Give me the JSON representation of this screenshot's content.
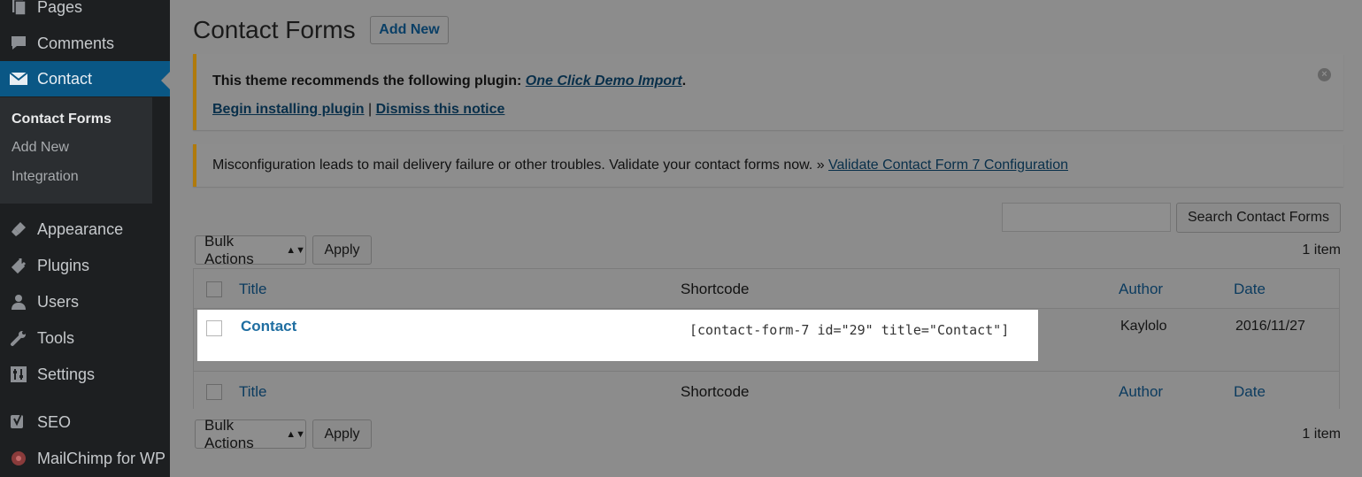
{
  "sidebar": {
    "items": [
      {
        "label": "Pages",
        "icon": "pages-icon"
      },
      {
        "label": "Comments",
        "icon": "comments-icon"
      },
      {
        "label": "Contact",
        "icon": "mail-icon",
        "active": true
      },
      {
        "label": "Appearance",
        "icon": "appearance-icon"
      },
      {
        "label": "Plugins",
        "icon": "plugins-icon"
      },
      {
        "label": "Users",
        "icon": "users-icon"
      },
      {
        "label": "Tools",
        "icon": "tools-icon"
      },
      {
        "label": "Settings",
        "icon": "settings-icon"
      },
      {
        "label": "SEO",
        "icon": "seo-icon"
      },
      {
        "label": "MailChimp for WP",
        "icon": "mailchimp-icon"
      }
    ],
    "submenu": [
      {
        "label": "Contact Forms",
        "current": true
      },
      {
        "label": "Add New"
      },
      {
        "label": "Integration"
      }
    ]
  },
  "header": {
    "title": "Contact Forms",
    "add_new_label": "Add New"
  },
  "notices": {
    "plugin_text": "This theme recommends the following plugin: ",
    "plugin_name": "One Click Demo Import",
    "plugin_end": ".",
    "begin_link": "Begin installing plugin",
    "separator": " | ",
    "dismiss_link": "Dismiss this notice",
    "misconfig_text": "Misconfiguration leads to mail delivery failure or other troubles. Validate your contact forms now. » ",
    "validate_link": "Validate Contact Form 7 Configuration"
  },
  "search": {
    "input_value": "",
    "button_label": "Search Contact Forms"
  },
  "bulk": {
    "label": "Bulk Actions",
    "apply_label": "Apply",
    "count": "1 item"
  },
  "table": {
    "columns": [
      "Title",
      "Shortcode",
      "Author",
      "Date"
    ],
    "rows": [
      {
        "title": "Contact",
        "shortcode": "[contact-form-7 id=\"29\" title=\"Contact\"]",
        "author": "Kaylolo",
        "date": "2016/11/27"
      }
    ]
  },
  "colors": {
    "sidebar_bg": "#1d1f21",
    "active_menu": "#0a5785",
    "link": "#0b3b5f",
    "notice_border": "#b07a0c"
  }
}
